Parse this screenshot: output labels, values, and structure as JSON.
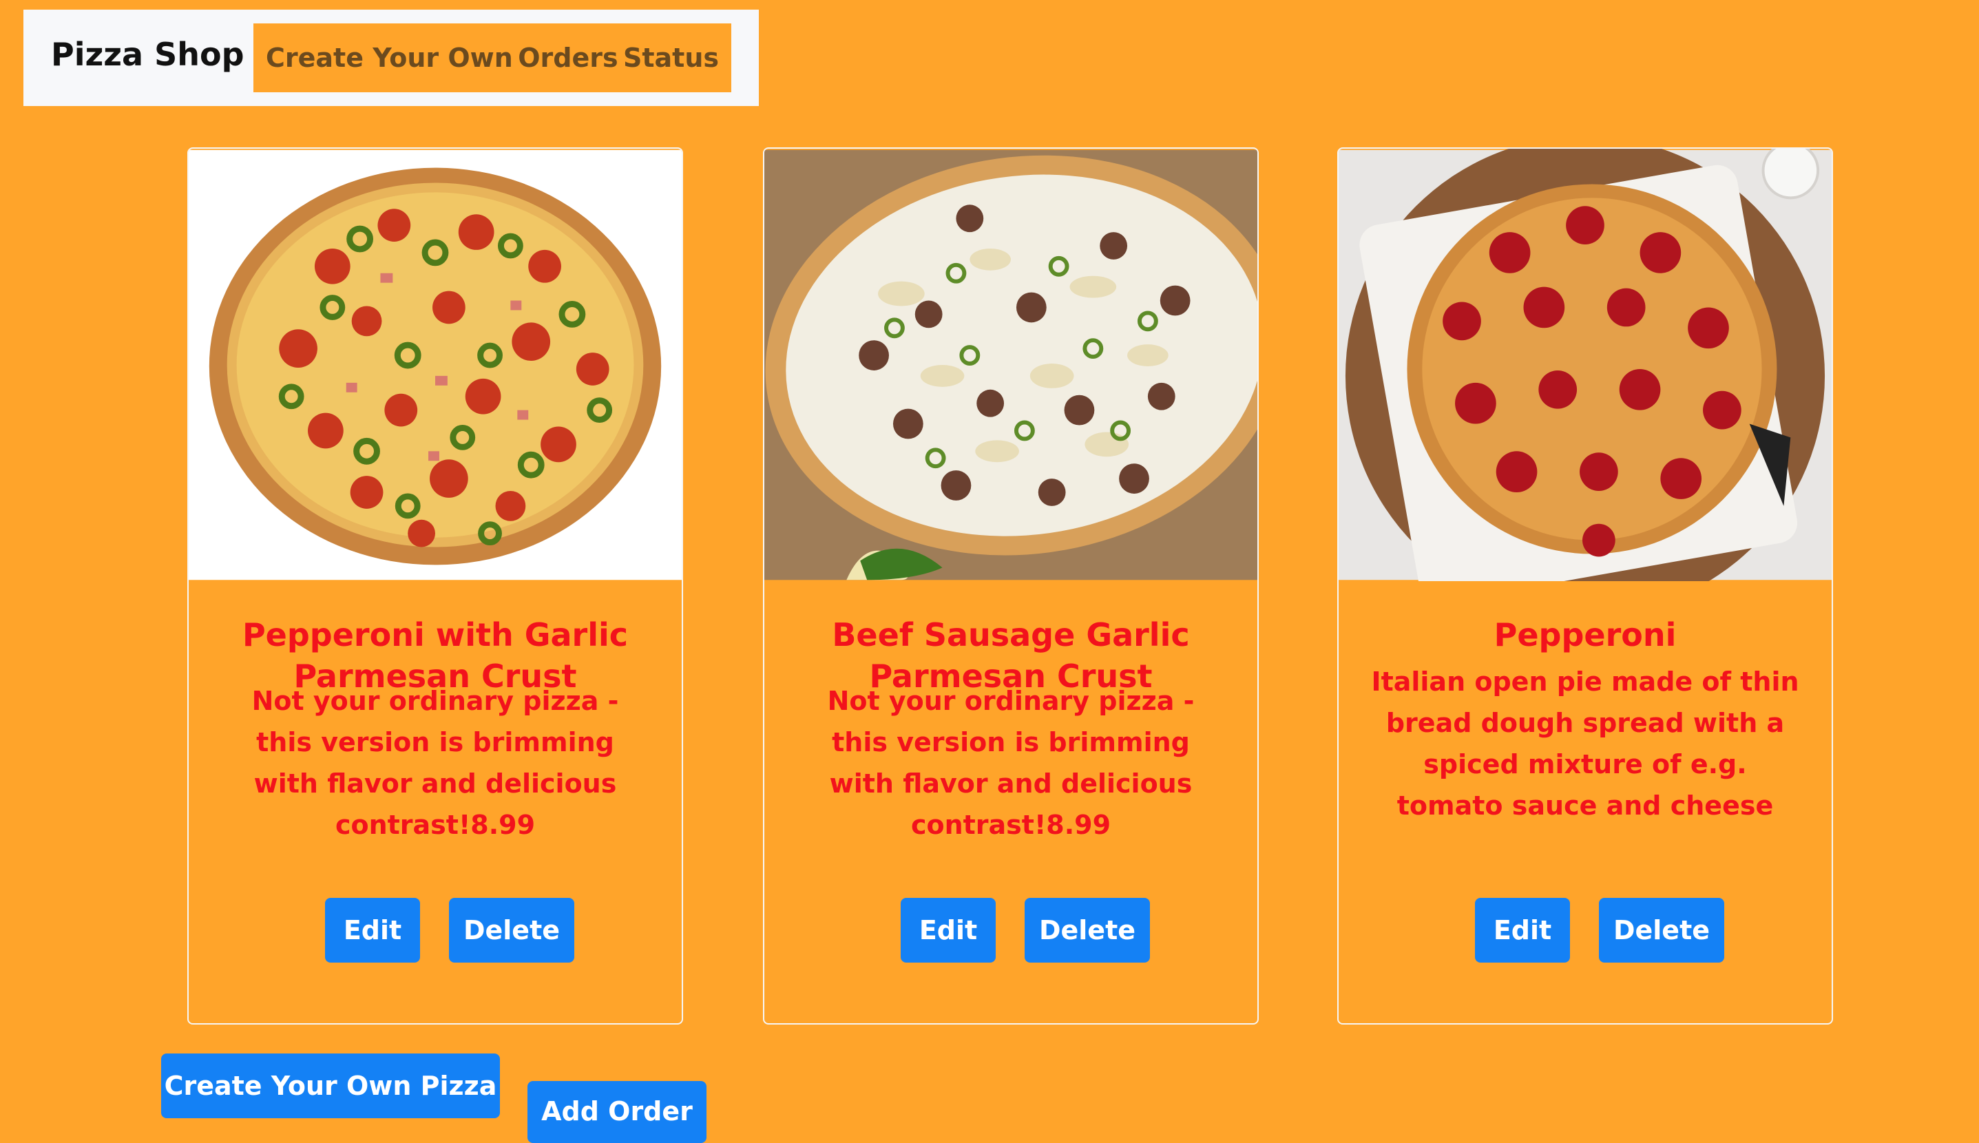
{
  "nav": {
    "brand": "Pizza Shop",
    "links": [
      "Create Your Own",
      "Orders",
      "Status"
    ]
  },
  "pizzas": [
    {
      "title": "Pepperoni with Garlic Parmesan Crust",
      "description": "Not your ordinary pizza - this version is brimming with flavor and delicious contrast!8.99",
      "edit": "Edit",
      "delete": "Delete"
    },
    {
      "title": "Beef Sausage Garlic Parmesan Crust",
      "description": "Not your ordinary pizza - this version is brimming with flavor and delicious contrast!8.99",
      "edit": "Edit",
      "delete": "Delete"
    },
    {
      "title": "Pepperoni",
      "description": "Italian open pie made of thin bread dough spread with a spiced mixture of e.g. tomato sauce and cheese",
      "edit": "Edit",
      "delete": "Delete"
    }
  ],
  "actions": {
    "create_pizza": "Create Your Own Pizza",
    "add_order": "Add Order"
  },
  "colors": {
    "background": "#FFA42A",
    "title_text": "#F2121C",
    "button": "#1481F5"
  },
  "icons": {
    "card_1_image": "pizza-pepperoni-jalapeno-image",
    "card_2_image": "pizza-sausage-pear-image",
    "card_3_image": "pizza-pepperoni-image"
  }
}
